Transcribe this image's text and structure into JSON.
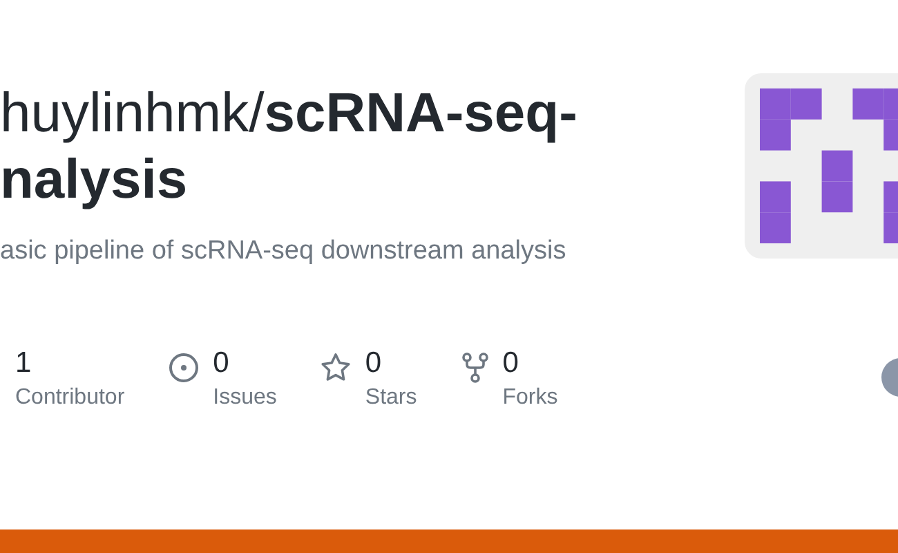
{
  "title": {
    "owner": "huylinhmk/",
    "repo": "scRNA-seq-nalysis"
  },
  "description": "asic pipeline of scRNA-seq downstream analysis",
  "stats": [
    {
      "kind": "contributors",
      "count": "1",
      "label": "Contributor"
    },
    {
      "kind": "issues",
      "count": "0",
      "label": "Issues"
    },
    {
      "kind": "stars",
      "count": "0",
      "label": "Stars"
    },
    {
      "kind": "forks",
      "count": "0",
      "label": "Forks"
    }
  ]
}
